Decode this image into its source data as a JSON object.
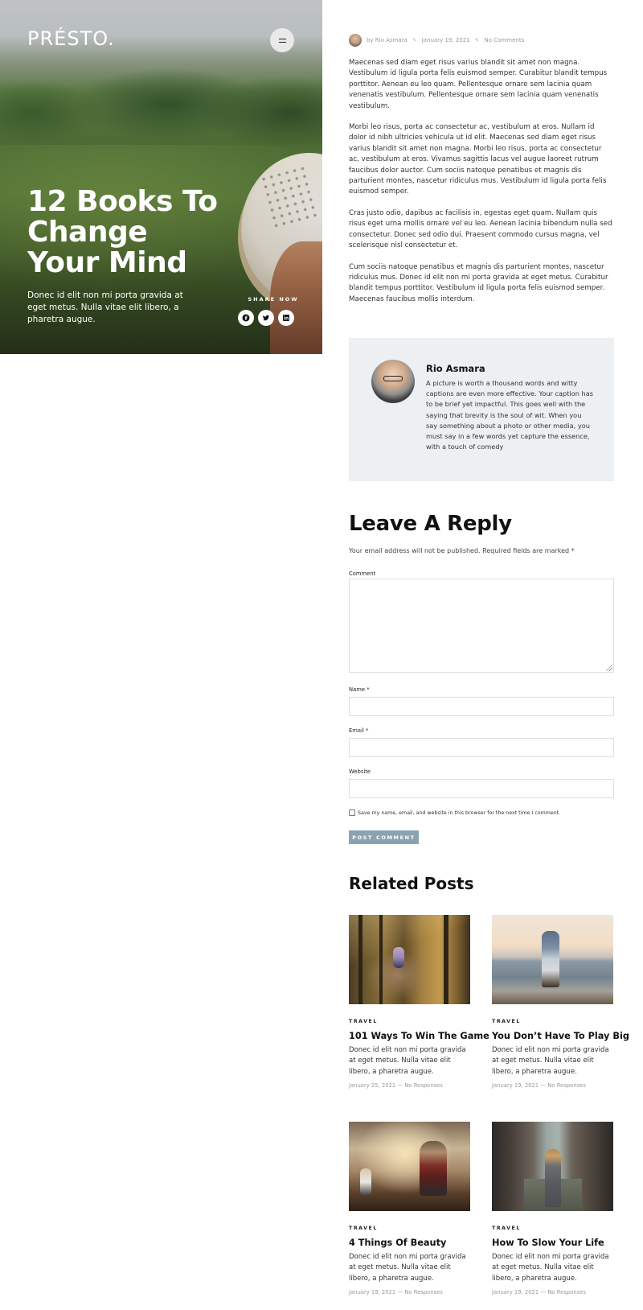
{
  "site": {
    "logo": "PRÉSTO."
  },
  "hero": {
    "title": "12 Books To Change Your Mind",
    "excerpt": "Donec id elit non mi porta gravida at eget metus. Nulla vitae elit libero, a pharetra augue.",
    "share_label": "SHARE NOW",
    "share_icons": [
      "facebook-icon",
      "twitter-icon",
      "linkedin-icon"
    ]
  },
  "meta": {
    "author": "by Rio Asmara",
    "date": "January 19, 2021",
    "comments": "No Comments"
  },
  "article": {
    "paragraphs": [
      "Maecenas sed diam eget risus varius blandit sit amet non magna. Vestibulum id ligula porta felis euismod semper. Curabitur blandit tempus porttitor. Aenean eu leo quam. Pellentesque ornare sem lacinia quam venenatis vestibulum. Pellentesque ornare sem lacinia quam venenatis vestibulum.",
      "Morbi leo risus, porta ac consectetur ac, vestibulum at eros. Nullam id dolor id nibh ultricies vehicula ut id elit. Maecenas sed diam eget risus varius blandit sit amet non magna. Morbi leo risus, porta ac consectetur ac, vestibulum at eros. Vivamus sagittis lacus vel augue laoreet rutrum faucibus dolor auctor. Cum sociis natoque penatibus et magnis dis parturient montes, nascetur ridiculus mus. Vestibulum id ligula porta felis euismod semper.",
      "Cras justo odio, dapibus ac facilisis in, egestas eget quam. Nullam quis risus eget urna mollis ornare vel eu leo. Aenean lacinia bibendum nulla sed consectetur. Donec sed odio dui. Praesent commodo cursus magna, vel scelerisque nisl consectetur et.",
      "Cum sociis natoque penatibus et magnis dis parturient montes, nascetur ridiculus mus. Donec id elit non mi porta gravida at eget metus. Curabitur blandit tempus porttitor. Vestibulum id ligula porta felis euismod semper. Maecenas faucibus mollis interdum."
    ]
  },
  "author_box": {
    "name": "Rio Asmara",
    "bio": "A picture is worth a thousand words and witty captions are even more effective. Your caption has to be brief yet impactful. This goes well with the saying that brevity is the soul of wit. When you say something about a photo or other media, you must say in a few words yet capture the essence, with a touch of comedy"
  },
  "reply": {
    "title": "Leave A Reply",
    "note": "Your email address will not be published. Required fields are marked *",
    "comment_label": "Comment",
    "name_label": "Name *",
    "email_label": "Email *",
    "website_label": "Website",
    "consent": "Save my name, email, and website in this browser for the next time I comment.",
    "submit": "POST COMMENT"
  },
  "related": {
    "title": "Related Posts",
    "posts": [
      {
        "category": "TRAVEL",
        "title": "101 Ways To Win The Game",
        "excerpt": "Donec id elit non mi porta gravida at eget metus. Nulla vitae elit libero, a pharetra augue.",
        "meta": "January 25, 2021 — No Responses"
      },
      {
        "category": "TRAVEL",
        "title": "You Don’t Have To Play Big",
        "excerpt": "Donec id elit non mi porta gravida at eget metus. Nulla vitae elit libero, a pharetra augue.",
        "meta": "January 19, 2021 — No Responses"
      },
      {
        "category": "TRAVEL",
        "title": "4 Things Of Beauty",
        "excerpt": "Donec id elit non mi porta gravida at eget metus. Nulla vitae elit libero, a pharetra augue.",
        "meta": "January 19, 2021 — No Responses"
      },
      {
        "category": "TRAVEL",
        "title": "How To Slow Your Life",
        "excerpt": "Donec id elit non mi porta gravida at eget metus. Nulla vitae elit libero, a pharetra augue.",
        "meta": "January 19, 2021 — No Responses"
      }
    ]
  }
}
